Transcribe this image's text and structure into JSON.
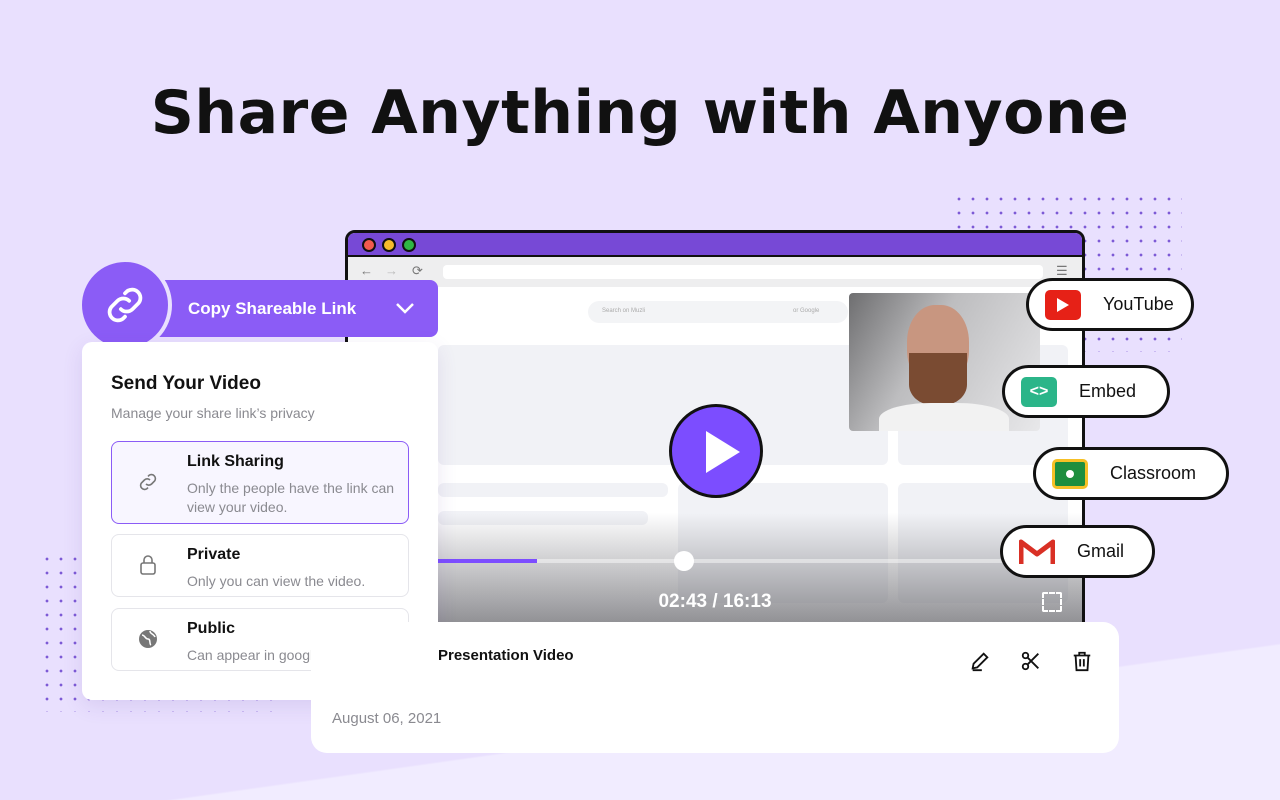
{
  "headline": "Share Anything with Anyone",
  "browser": {
    "search_placeholder": "Search on Muzli",
    "search_alt": "or Google"
  },
  "player": {
    "time": "02:43 / 16:13",
    "progress_percent": 17
  },
  "copy_button": {
    "label": "Copy Shareable Link"
  },
  "share_card": {
    "title": "Send Your Video",
    "subtitle": "Manage your share link’s privacy",
    "options": [
      {
        "title": "Link Sharing",
        "desc": "Only the people have the link can view your video.",
        "selected": true,
        "icon": "link-icon"
      },
      {
        "title": "Private",
        "desc": "Only you can view the video.",
        "selected": false,
        "icon": "lock-icon"
      },
      {
        "title": "Public",
        "desc": "Can appear in google search.",
        "selected": false,
        "icon": "globe-icon"
      }
    ]
  },
  "video": {
    "title": "Presentation Video",
    "date": "August 06, 2021"
  },
  "destinations": [
    {
      "label": "YouTube",
      "color": "#e62117"
    },
    {
      "label": "Embed",
      "color": "#2bb589"
    },
    {
      "label": "Classroom",
      "color": "#1e8e3e"
    },
    {
      "label": "Gmail",
      "color": "#d93025"
    }
  ],
  "colors": {
    "accent": "#8b5cf6",
    "background": "#e9e0fe"
  }
}
